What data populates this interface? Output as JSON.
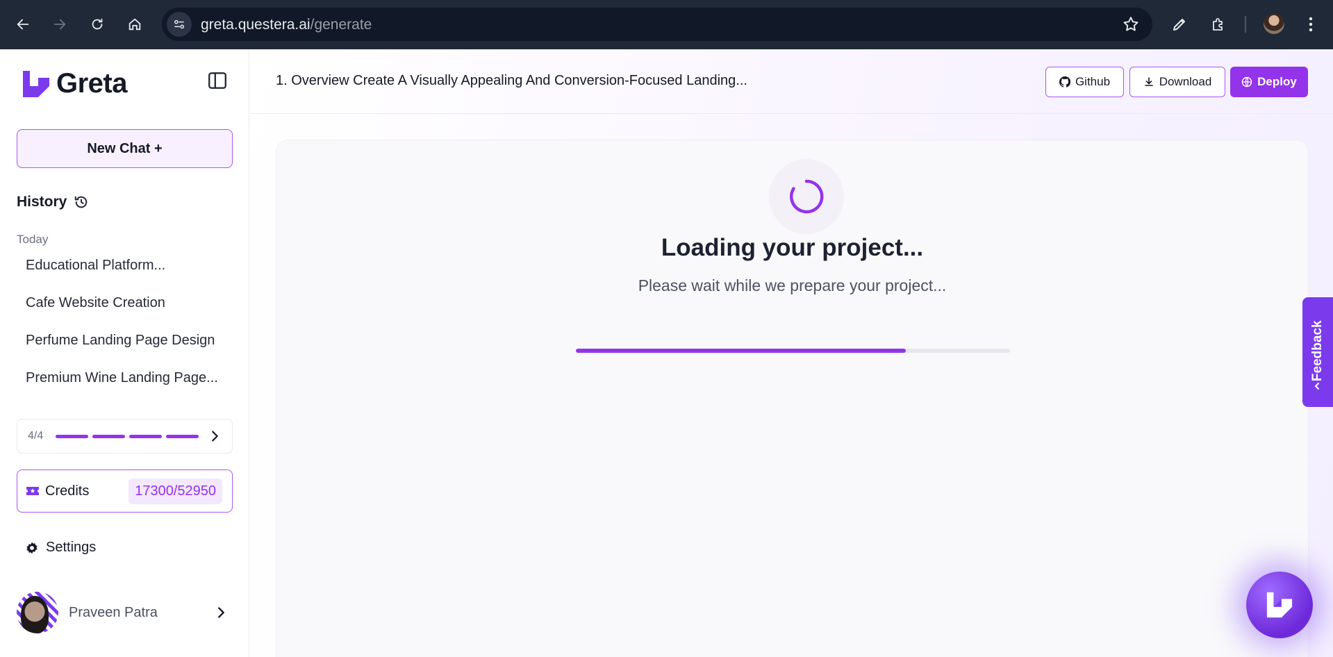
{
  "browser": {
    "url_domain": "greta.questera.ai",
    "url_path": "/generate"
  },
  "sidebar": {
    "logo_text": "Greta",
    "new_chat_label": "New Chat +",
    "history_label": "History",
    "today_label": "Today",
    "history_items": [
      "Educational Platform...",
      "Cafe Website Creation",
      "Perfume Landing Page Design",
      "Premium Wine Landing Page..."
    ],
    "pager_count": "4/4",
    "credits_label": "Credits",
    "credits_value": "17300/52950",
    "settings_label": "Settings",
    "user_name": "Praveen Patra"
  },
  "main": {
    "title": "1. Overview Create A Visually Appealing And Conversion-Focused Landing...",
    "github_label": "Github",
    "download_label": "Download",
    "deploy_label": "Deploy",
    "loading_title": "Loading your project...",
    "loading_subtitle": "Please wait while we prepare your project...",
    "progress_fraction": 0.76
  },
  "feedback_label": "Feedback",
  "colors": {
    "accent": "#9333ea",
    "accent_light": "#f3e8ff",
    "browser_bar": "#1f2937",
    "feedback_bg": "#7c3aed"
  },
  "icons": [
    "back-icon",
    "forward-icon",
    "reload-icon",
    "home-icon",
    "site-info-icon",
    "star-icon",
    "pen-icon",
    "extensions-icon",
    "menu-icon",
    "sidebar-toggle-icon",
    "history-icon",
    "chevron-right-icon",
    "ticket-icon",
    "gear-icon",
    "github-icon",
    "download-icon",
    "globe-icon",
    "chevron-left-icon"
  ]
}
